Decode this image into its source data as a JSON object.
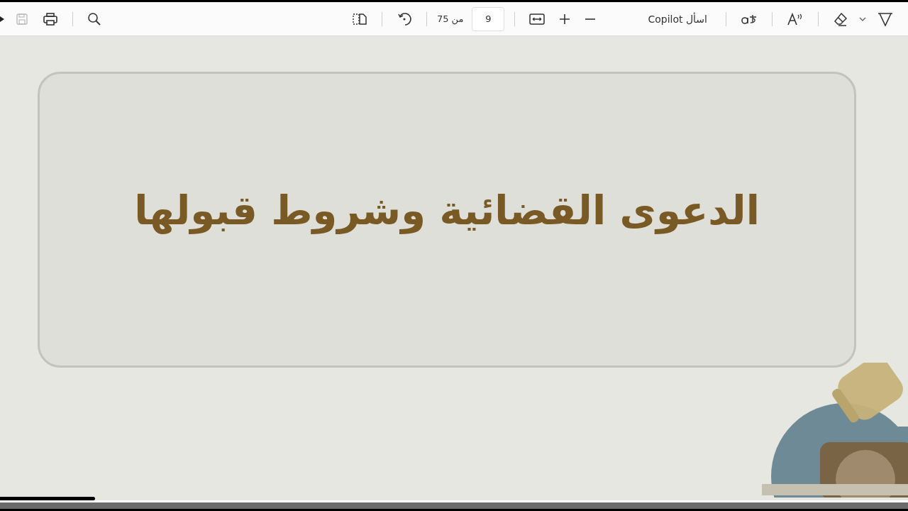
{
  "toolbar": {
    "save_button": {
      "disabled": true
    },
    "page_number": "9",
    "page_total": "من 75",
    "ask_copilot": "اسأل Copilot"
  },
  "slide": {
    "title": "الدعوى القضائية وشروط قبولها"
  },
  "video_progress": {
    "level": 0.105
  }
}
